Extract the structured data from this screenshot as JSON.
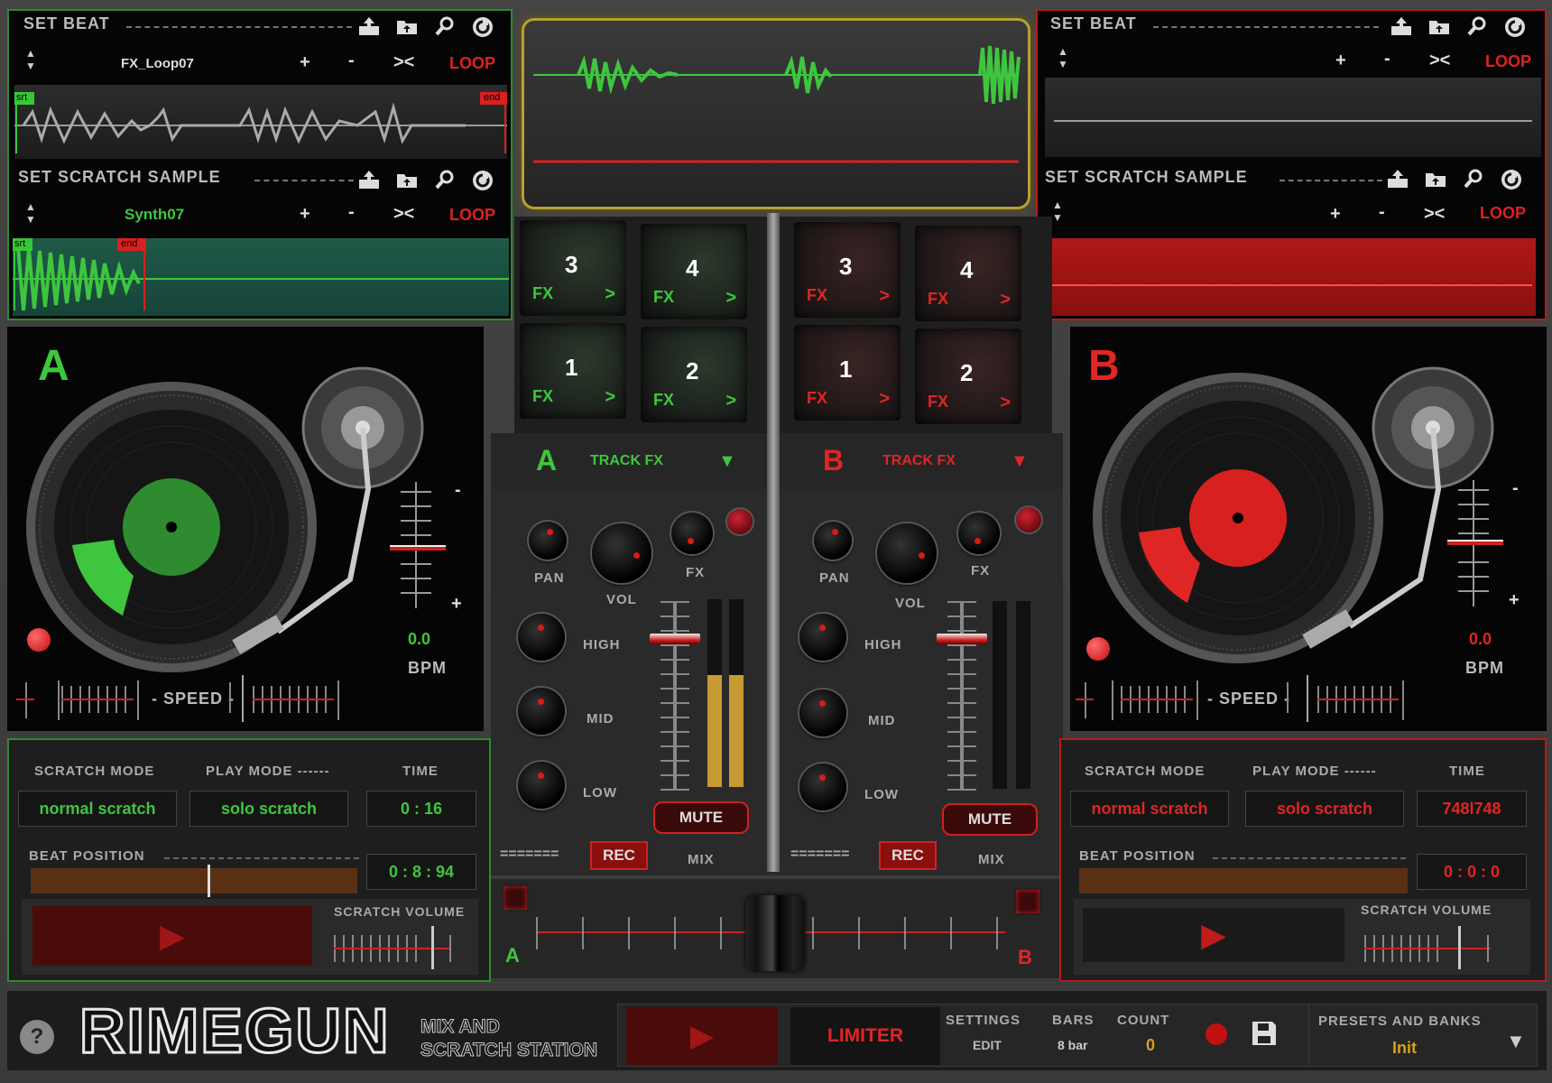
{
  "deckA": {
    "set_beat_label": "SET BEAT",
    "beat_file": "FX_Loop07",
    "plus": "+",
    "minus": "-",
    "swap": "><",
    "loop": "LOOP",
    "srt": "srt",
    "end": "end",
    "scratch_label": "SET SCRATCH SAMPLE",
    "scratch_file": "Synth07",
    "letter": "A",
    "bpm_value": "0.0",
    "bpm_label": "BPM",
    "speed_label": "- SPEED -",
    "scratch_mode_label": "SCRATCH MODE",
    "scratch_mode_value": "normal scratch",
    "play_mode_label": "PLAY MODE ------",
    "play_mode_value": "solo scratch",
    "time_label": "TIME",
    "time_value": "0 : 16",
    "beat_position_label": "BEAT POSITION",
    "beat_position_value": "0 : 8 : 94",
    "scratch_volume_label": "SCRATCH VOLUME",
    "accent": "#3ec63e"
  },
  "deckB": {
    "set_beat_label": "SET BEAT",
    "plus": "+",
    "minus": "-",
    "swap": "><",
    "loop": "LOOP",
    "scratch_label": "SET SCRATCH SAMPLE",
    "letter": "B",
    "bpm_value": "0.0",
    "bpm_label": "BPM",
    "speed_label": "- SPEED -",
    "scratch_mode_label": "SCRATCH MODE",
    "scratch_mode_value": "normal scratch",
    "play_mode_label": "PLAY MODE ------",
    "play_mode_value": "solo scratch",
    "time_label": "TIME",
    "time_value": "748l748",
    "beat_position_label": "BEAT POSITION",
    "beat_position_value": "0 : 0 : 0",
    "scratch_volume_label": "SCRATCH VOLUME",
    "accent": "#e02525"
  },
  "pads": {
    "fx": "FX",
    "arrow": ">",
    "numbers": [
      "3",
      "4",
      "1",
      "2"
    ]
  },
  "mixer": {
    "a_letter": "A",
    "b_letter": "B",
    "track_fx": "TRACK FX",
    "pan": "PAN",
    "vol": "VOL",
    "fx": "FX",
    "high": "HIGH",
    "mid": "MID",
    "low": "LOW",
    "mute": "MUTE",
    "rec": "REC",
    "mix": "MIX",
    "eq": "======="
  },
  "crossfader": {
    "a": "A",
    "b": "B"
  },
  "footer": {
    "help": "?",
    "logo": "RIMEGUN",
    "tagline1": "MIX AND",
    "tagline2": "SCRATCH STATION",
    "limiter": "LIMITER",
    "settings_label": "SETTINGS",
    "settings_value": "EDIT",
    "bars_label": "BARS",
    "bars_value": "8 bar",
    "count_label": "COUNT",
    "count_value": "0",
    "presets_label": "PRESETS AND BANKS",
    "presets_value": "Init"
  },
  "icons": [
    "upload-icon",
    "folder-icon",
    "search-icon",
    "refresh-icon",
    "play-icon",
    "record-icon",
    "save-icon",
    "chevron-down-icon"
  ]
}
